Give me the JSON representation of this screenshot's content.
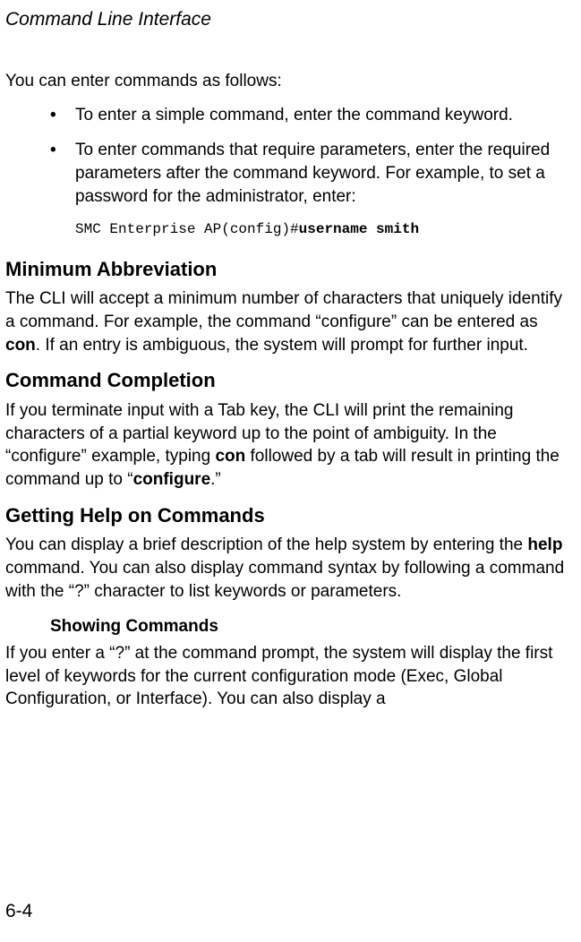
{
  "header": {
    "title": "Command Line Interface"
  },
  "intro": {
    "lead": "You can enter commands as follows:"
  },
  "bullets": {
    "b1": "To enter a simple command, enter the command keyword.",
    "b2": "To enter commands that require parameters, enter the required parameters after the command keyword. For example, to set a password for the administrator, enter:"
  },
  "code": {
    "prefix": "SMC Enterprise AP(config)#",
    "cmd": "username smith"
  },
  "sections": {
    "min_abbrev": {
      "title": "Minimum Abbreviation",
      "p1a": "The CLI will accept a minimum number of characters that uniquely identify a command. For example, the command “configure” can be entered as ",
      "p1b": "con",
      "p1c": ". If an entry is ambiguous, the system will prompt for further input."
    },
    "cmd_completion": {
      "title": "Command Completion",
      "p1a": "If you terminate input with a Tab key, the CLI will print the remaining characters of a partial keyword up to the point of ambiguity. In the “configure” example, typing ",
      "p1b": "con",
      "p1c": " followed by a tab will result in printing the command up to “",
      "p1d": "configure",
      "p1e": ".”"
    },
    "help": {
      "title": "Getting Help on Commands",
      "p1a": "You can display a brief description of the help system by entering the ",
      "p1b": "help",
      "p1c": " command. You can also display command syntax by following a command with the “?” character to list keywords or parameters.",
      "sub_title": "Showing Commands",
      "p2": "If you enter a “?” at the command prompt, the system will display the first level of keywords for the current configuration mode (Exec, Global Configuration, or Interface). You can also display a"
    }
  },
  "footer": {
    "page": "6-4"
  }
}
